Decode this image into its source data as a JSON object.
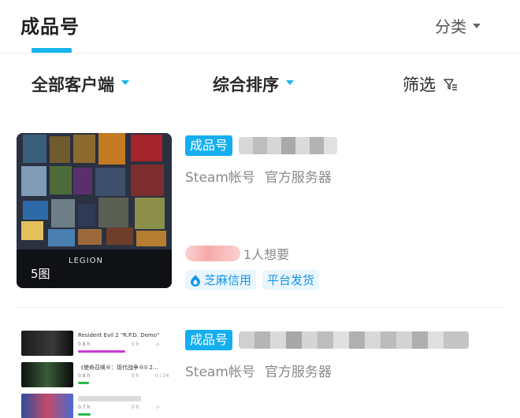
{
  "header": {
    "title": "成品号",
    "category_label": "分类"
  },
  "filters": {
    "all_clients": "全部客户端",
    "sort": "综合排序",
    "filter": "筛选"
  },
  "listings": [
    {
      "badge": "成品号",
      "meta": [
        "Steam帐号",
        "官方服务器"
      ],
      "image_count": "5图",
      "image_caption": "LEGION",
      "want_text": "1人想要",
      "tags": [
        {
          "label": "芝麻信用",
          "icon": "sesame-credit-icon"
        },
        {
          "label": "平台发货",
          "icon": null
        }
      ]
    },
    {
      "badge": "成品号",
      "meta": [
        "Steam帐号",
        "官方服务器"
      ],
      "games": [
        {
          "title": "Resident Evil 2 \"R.P.D. Demo\"",
          "hours": "0.8 h",
          "stat1": "0 h",
          "stat2": "-/-",
          "bar_color": "#c93ad6",
          "progress": 0.85
        },
        {
          "title": "《使命召唤®：现代战争®II 2…",
          "hours": "0.8 h",
          "stat1": "0 h",
          "stat2": "0 / 24",
          "bar_color": "#29b84a",
          "progress": 0.2
        },
        {
          "title": "",
          "hours": "0.7 h",
          "stat1": "0 h",
          "stat2": "-/-",
          "bar_color": "#29b84a",
          "progress": 0.25
        }
      ]
    }
  ],
  "colors": {
    "accent": "#16b4ee",
    "badge": "#15aef0",
    "tag_text": "#1596e6",
    "tag_bg": "#eaf6fe"
  }
}
